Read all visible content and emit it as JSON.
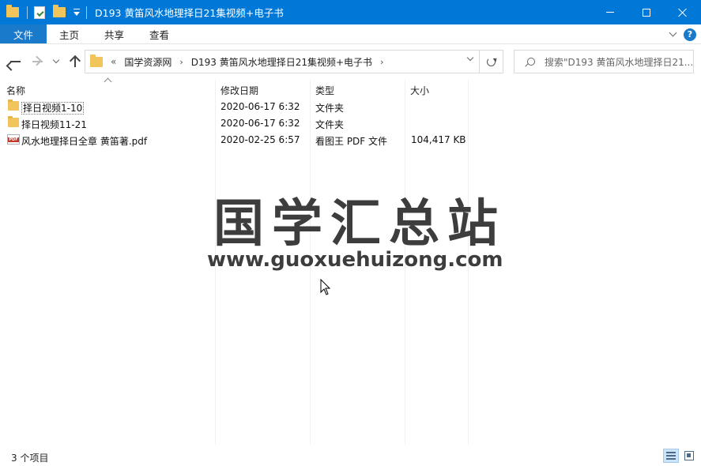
{
  "window": {
    "title": "D193 黄笛风水地理择日21集视频+电子书"
  },
  "ribbon": {
    "tabs": [
      "文件",
      "主页",
      "共享",
      "查看"
    ]
  },
  "address": {
    "overflow": "«",
    "crumbs": [
      "国学资源网",
      "D193 黄笛风水地理择日21集视频+电子书"
    ]
  },
  "search": {
    "placeholder": "搜索\"D193 黄笛风水地理择日21..."
  },
  "columns": {
    "name": "名称",
    "modified": "修改日期",
    "type": "类型",
    "size": "大小"
  },
  "files": [
    {
      "name": "择日视频1-10",
      "modified": "2020-06-17 6:32",
      "type": "文件夹",
      "size": "",
      "icon": "folder-icon"
    },
    {
      "name": "择日视频11-21",
      "modified": "2020-06-17 6:32",
      "type": "文件夹",
      "size": "",
      "icon": "folder-icon"
    },
    {
      "name": "风水地理择日全章 黄笛著.pdf",
      "modified": "2020-02-25 6:57",
      "type": "看图王 PDF 文件",
      "size": "104,417 KB",
      "icon": "pdf-icon"
    }
  ],
  "watermark": {
    "text": "国学汇总站",
    "url": "www.guoxuehuizong.com"
  },
  "status": {
    "count": "3 个项目"
  },
  "colors": {
    "titlebar": "#0078d7",
    "file_tab": "#1979ca",
    "folder": "#f2c55c"
  }
}
